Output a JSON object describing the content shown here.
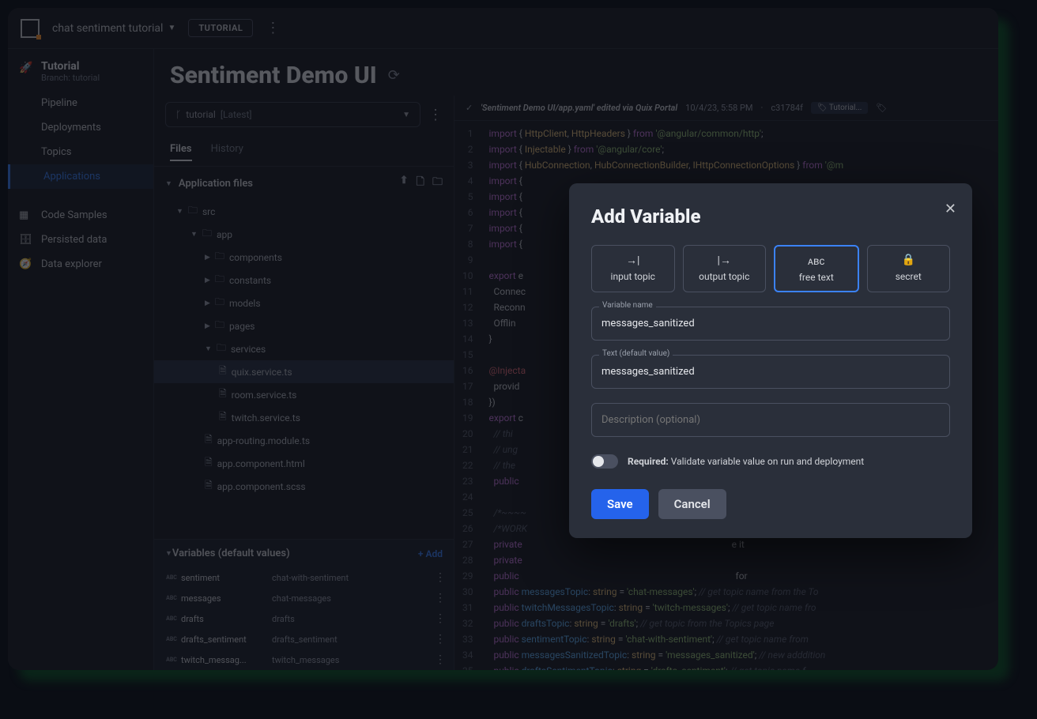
{
  "topbar": {
    "project": "chat sentiment tutorial",
    "badge": "TUTORIAL"
  },
  "sidebar": {
    "title": "Tutorial",
    "branch": "Branch: tutorial",
    "items": [
      "Pipeline",
      "Deployments",
      "Topics",
      "Applications"
    ],
    "active": 3,
    "other": [
      "Code Samples",
      "Persisted data",
      "Data explorer"
    ]
  },
  "page": {
    "title": "Sentiment Demo UI"
  },
  "branch_select": {
    "name": "tutorial",
    "tag": "[Latest]"
  },
  "tabs": [
    "Files",
    "History"
  ],
  "files_header": "Application files",
  "tree": [
    {
      "d": 1,
      "t": "folder",
      "n": "src",
      "open": true
    },
    {
      "d": 2,
      "t": "folder",
      "n": "app",
      "open": true
    },
    {
      "d": 3,
      "t": "folder",
      "n": "components"
    },
    {
      "d": 3,
      "t": "folder",
      "n": "constants"
    },
    {
      "d": 3,
      "t": "folder",
      "n": "models"
    },
    {
      "d": 3,
      "t": "folder",
      "n": "pages"
    },
    {
      "d": 3,
      "t": "folder",
      "n": "services",
      "open": true
    },
    {
      "d": 4,
      "t": "file",
      "n": "quix.service.ts",
      "sel": true
    },
    {
      "d": 4,
      "t": "file",
      "n": "room.service.ts"
    },
    {
      "d": 4,
      "t": "file",
      "n": "twitch.service.ts"
    },
    {
      "d": 3,
      "t": "file",
      "n": "app-routing.module.ts"
    },
    {
      "d": 3,
      "t": "file",
      "n": "app.component.html"
    },
    {
      "d": 3,
      "t": "file",
      "n": "app.component.scss"
    }
  ],
  "vars_header": "Variables (default values)",
  "add_label": "+ Add",
  "vars": [
    {
      "n": "sentiment",
      "v": "chat-with-sentiment"
    },
    {
      "n": "messages",
      "v": "chat-messages"
    },
    {
      "n": "drafts",
      "v": "drafts"
    },
    {
      "n": "drafts_sentiment",
      "v": "drafts_sentiment"
    },
    {
      "n": "twitch_messag...",
      "v": "twitch_messages"
    }
  ],
  "commit": {
    "msg": "'Sentiment Demo UI/app.yaml' edited via Quix Portal",
    "date": "10/4/23, 5:58 PM",
    "hash": "c31784f",
    "tag": "Tutorial..."
  },
  "modal": {
    "title": "Add Variable",
    "types": [
      "input topic",
      "output topic",
      "free text",
      "secret"
    ],
    "active": 2,
    "name_label": "Variable name",
    "name_value": "messages_sanitized",
    "text_label": "Text (default value)",
    "text_value": "messages_sanitized",
    "desc_placeholder": "Description (optional)",
    "required_label": "Required:",
    "required_desc": "Validate variable value on run and deployment",
    "save": "Save",
    "cancel": "Cancel"
  }
}
